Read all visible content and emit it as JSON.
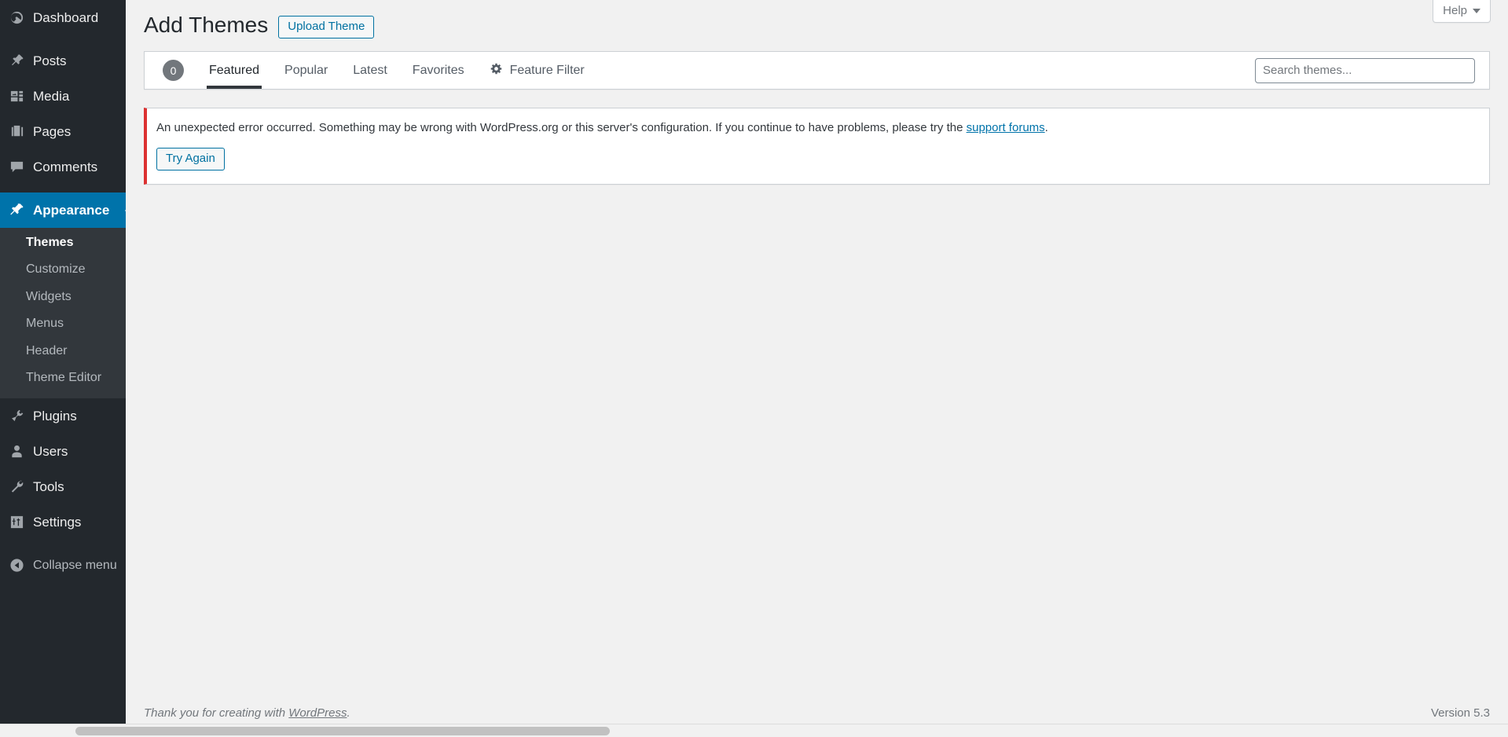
{
  "sidebar": {
    "items": [
      {
        "label": "Dashboard",
        "icon": "dashboard-icon",
        "current": false
      },
      {
        "label": "Posts",
        "icon": "pin-icon",
        "current": false
      },
      {
        "label": "Media",
        "icon": "media-icon",
        "current": false
      },
      {
        "label": "Pages",
        "icon": "pages-icon",
        "current": false
      },
      {
        "label": "Comments",
        "icon": "comments-icon",
        "current": false
      },
      {
        "label": "Appearance",
        "icon": "appearance-brush-icon",
        "current": true
      },
      {
        "label": "Plugins",
        "icon": "plugins-icon",
        "current": false
      },
      {
        "label": "Users",
        "icon": "users-icon",
        "current": false
      },
      {
        "label": "Tools",
        "icon": "tools-wrench-icon",
        "current": false
      },
      {
        "label": "Settings",
        "icon": "settings-sliders-icon",
        "current": false
      }
    ],
    "submenu": [
      {
        "label": "Themes",
        "current": true
      },
      {
        "label": "Customize",
        "current": false
      },
      {
        "label": "Widgets",
        "current": false
      },
      {
        "label": "Menus",
        "current": false
      },
      {
        "label": "Header",
        "current": false
      },
      {
        "label": "Theme Editor",
        "current": false
      }
    ],
    "collapse": {
      "label": "Collapse menu",
      "icon": "collapse-arrow-icon"
    }
  },
  "screen_meta": {
    "help_label": "Help",
    "help_caret": "▼"
  },
  "header": {
    "title": "Add Themes",
    "upload_button": "Upload Theme"
  },
  "nav": {
    "count": "0",
    "tabs": [
      {
        "label": "Featured",
        "current": true
      },
      {
        "label": "Popular",
        "current": false
      },
      {
        "label": "Latest",
        "current": false
      },
      {
        "label": "Favorites",
        "current": false
      },
      {
        "label": "Feature Filter",
        "current": false,
        "icon": "gear-icon"
      }
    ]
  },
  "search": {
    "placeholder": "Search themes...",
    "value": ""
  },
  "notice": {
    "text_before_link": "An unexpected error occurred. Something may be wrong with WordPress.org or this server's configuration. If you continue to have problems, please try the ",
    "link_text": "support forums",
    "text_after_link": ".",
    "button_label": "Try Again",
    "accent_color": "#dc3232"
  },
  "footer": {
    "thanks_before": "Thank you for creating with ",
    "thanks_link": "WordPress",
    "thanks_after": ".",
    "version": "Version 5.3"
  },
  "colors": {
    "sidebar_bg": "#23282d",
    "submenu_bg": "#32373c",
    "accent_blue": "#0073aa",
    "page_bg": "#f1f1f1"
  }
}
